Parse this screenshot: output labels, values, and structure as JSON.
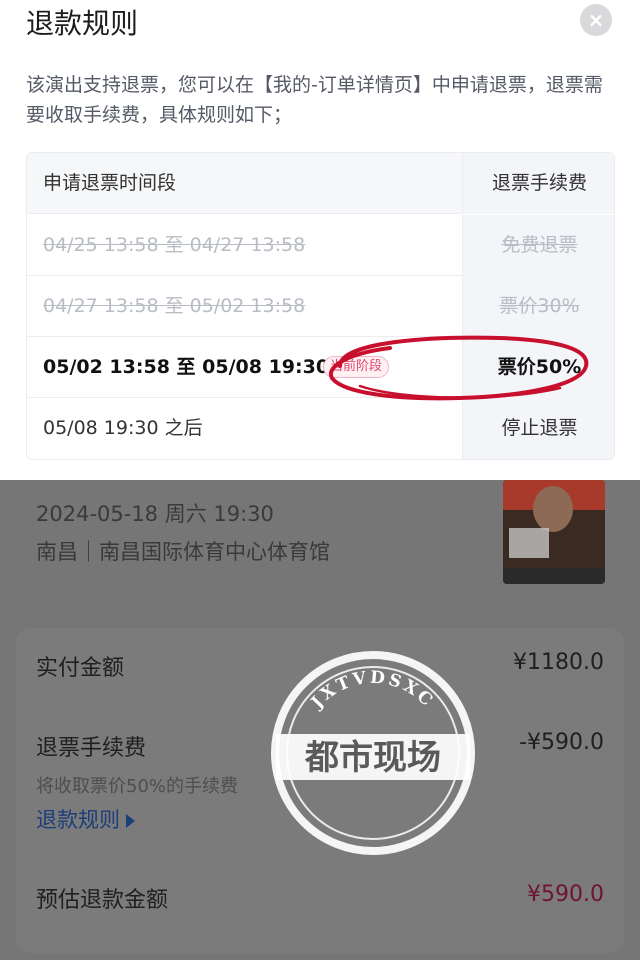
{
  "sheet": {
    "title": "退款规则",
    "close_glyph": "×",
    "description": "该演出支持退票，您可以在【我的-订单详情页】中申请退票，退票需要收取手续费，具体规则如下；",
    "table": {
      "header": {
        "period": "申请退票时间段",
        "fee": "退票手续费"
      },
      "rows": [
        {
          "period": "04/25 13:58 至 04/27 13:58",
          "fee": "免费退票",
          "state": "past"
        },
        {
          "period": "04/27 13:58 至 05/02 13:58",
          "fee": "票价30%",
          "state": "past"
        },
        {
          "period": "05/02 13:58 至 05/08 19:30",
          "fee": "票价50%",
          "state": "current",
          "badge": "当前阶段"
        },
        {
          "period": "05/08 19:30 之后",
          "fee": "停止退票",
          "state": "future"
        }
      ]
    }
  },
  "event": {
    "datetime": "2024-05-18 周六 19:30",
    "venue": "南昌｜南昌国际体育中心体育馆"
  },
  "fees": {
    "paid_label": "实付金额",
    "paid_value": "¥1180.0",
    "refund_fee_label": "退票手续费",
    "refund_fee_value": "-¥590.0",
    "refund_fee_note": "将收取票价50%的手续费",
    "rules_link": "退款规则",
    "estimate_label": "预估退款金额",
    "estimate_value": "¥590.0"
  },
  "watermark": {
    "top_text": "JXTVDSXC",
    "main_text": "都市现场"
  },
  "colors": {
    "accent": "#e0486e",
    "annotation": "#c8102e",
    "link": "#1b3f7a",
    "overlay": "#767676"
  },
  "icons": {
    "close": "close-icon",
    "link_arrow": "triangle-right-icon"
  }
}
